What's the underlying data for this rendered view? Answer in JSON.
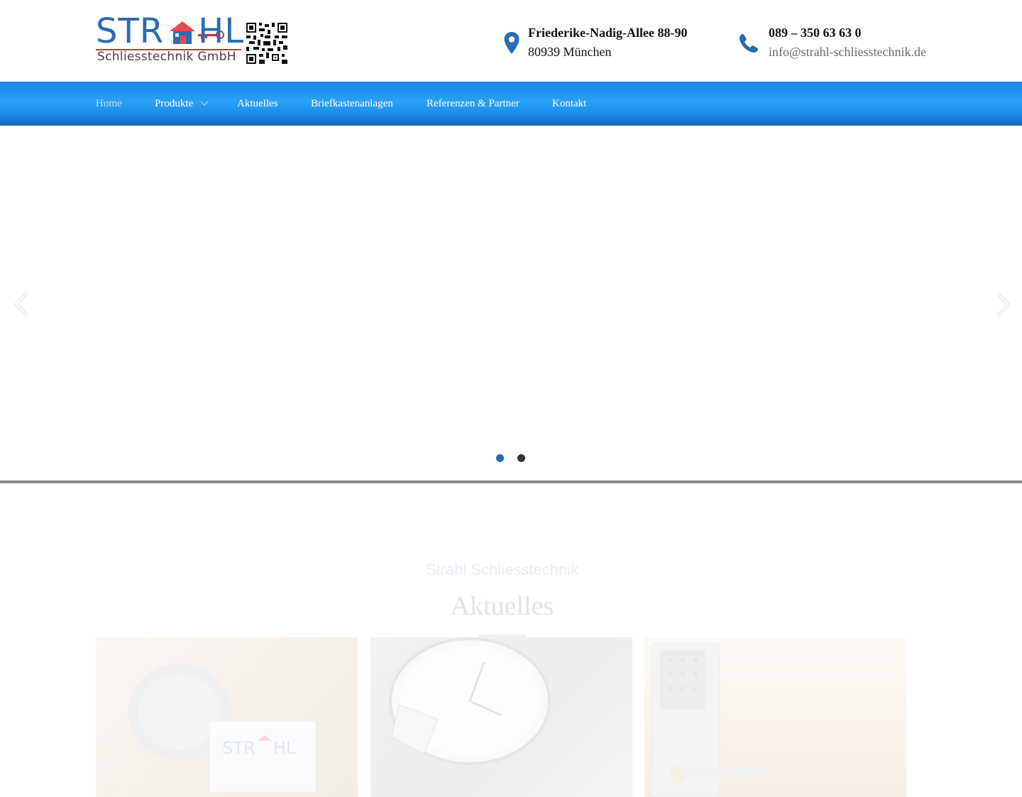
{
  "header": {
    "logo": {
      "brand_text": "STRAHL",
      "brand_sub": "Schliesstechnik GmbH"
    },
    "address": {
      "street": "Friederike-Nadig-Allee 88-90",
      "city": "80939 München",
      "icon": "map-marker-icon"
    },
    "phone": {
      "number": "089 – 350 63 63 0",
      "email": "info@strahl-schliesstechnik.de",
      "icon": "phone-icon"
    }
  },
  "nav": {
    "items": [
      {
        "label": "Home",
        "active": true
      },
      {
        "label": "Produkte",
        "has_dropdown": true
      },
      {
        "label": "Aktuelles"
      },
      {
        "label": "Briefkastenanlagen"
      },
      {
        "label": "Referenzen & Partner"
      },
      {
        "label": "Kontakt"
      }
    ],
    "colors": {
      "gradient_top": "#1a86e6",
      "gradient_bottom": "#1565c7"
    }
  },
  "slider": {
    "prev_icon": "chevron-left-icon",
    "next_icon": "chevron-right-icon",
    "total_slides": 2,
    "active_slide": 1,
    "colors": {
      "active_dot": "#2b6cb3",
      "inactive_dot": "#333333"
    }
  },
  "news": {
    "subtitle": "Strahl Schliesstechnik",
    "title": "Aktuelles",
    "cards": [
      {
        "image": "lock-cylinder-and-business-card"
      },
      {
        "image": "clock-cut-into-slices"
      },
      {
        "image": "electronic-keypad-door-lock"
      }
    ]
  },
  "colors": {
    "accent": "#2b6cb3",
    "brand_red": "#c8333a"
  }
}
